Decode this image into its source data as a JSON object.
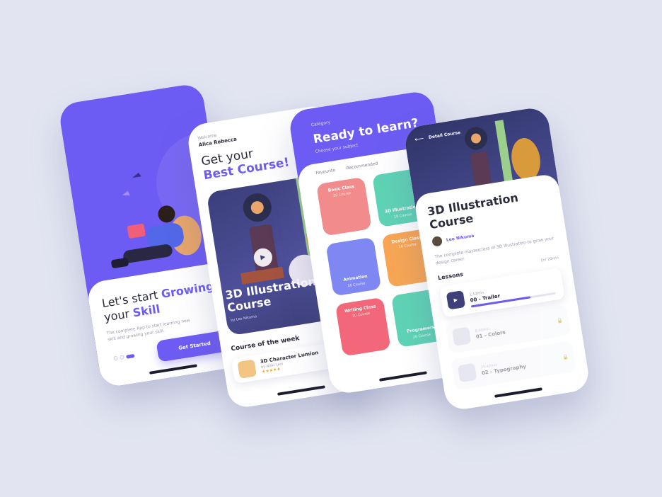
{
  "colors": {
    "brand": "#6d5cf3",
    "background": "#e2e5f1"
  },
  "onboarding": {
    "headline_pre": "Let's start ",
    "headline_accent1": "Growing",
    "headline_mid": "your ",
    "headline_accent2": "Skill",
    "subtitle": "The complete App to start learning new skill and growing your skill.",
    "cta": "Get Started"
  },
  "home": {
    "welcome": "Welcome",
    "user": "Alica Rebecca",
    "headline1": "Get your",
    "headline2": "Best Course!",
    "featured": {
      "title": "3D Illustration Course",
      "author": "by Leo Nikuma"
    },
    "section": "Course of the week",
    "week": {
      "title": "3D Character Lumion",
      "author": "by Niski Lexi",
      "stars": "★★★★★"
    }
  },
  "category": {
    "label": "Category",
    "headline": "Ready to learn?",
    "sub": "Choose your subject",
    "tabs": [
      "Favourite",
      "Recommended"
    ],
    "tiles": [
      {
        "title": "Basic Class",
        "count": "20 Course",
        "color": "#f28b8b"
      },
      {
        "title": "3D Illustration",
        "count": "19 Course",
        "color": "#5fd3b5"
      },
      {
        "title": "Animation",
        "count": "16 Course",
        "color": "#7e87f2"
      },
      {
        "title": "Design Class",
        "count": "16 Course",
        "color": "#f8a654"
      },
      {
        "title": "Writing Class",
        "count": "20 Course",
        "color": "#f2677a"
      },
      {
        "title": "Programers",
        "count": "20 Course",
        "color": "#5fd3b5"
      }
    ]
  },
  "detail": {
    "nav": "Detail Course",
    "title": "3D Illustration Course",
    "author": "Leo Nikuma",
    "desc": "The complete masterclass of 3D Illustration to grow your design career.",
    "lessons_label": "Lessons",
    "total": "1hr 20min",
    "lessons": [
      {
        "dur": "1:10min",
        "name": "00 - Trailer",
        "progress": 0.7
      },
      {
        "dur": "8:40min",
        "name": "01 - Colors"
      },
      {
        "dur": "15:40min",
        "name": "02 - Typography"
      }
    ]
  }
}
